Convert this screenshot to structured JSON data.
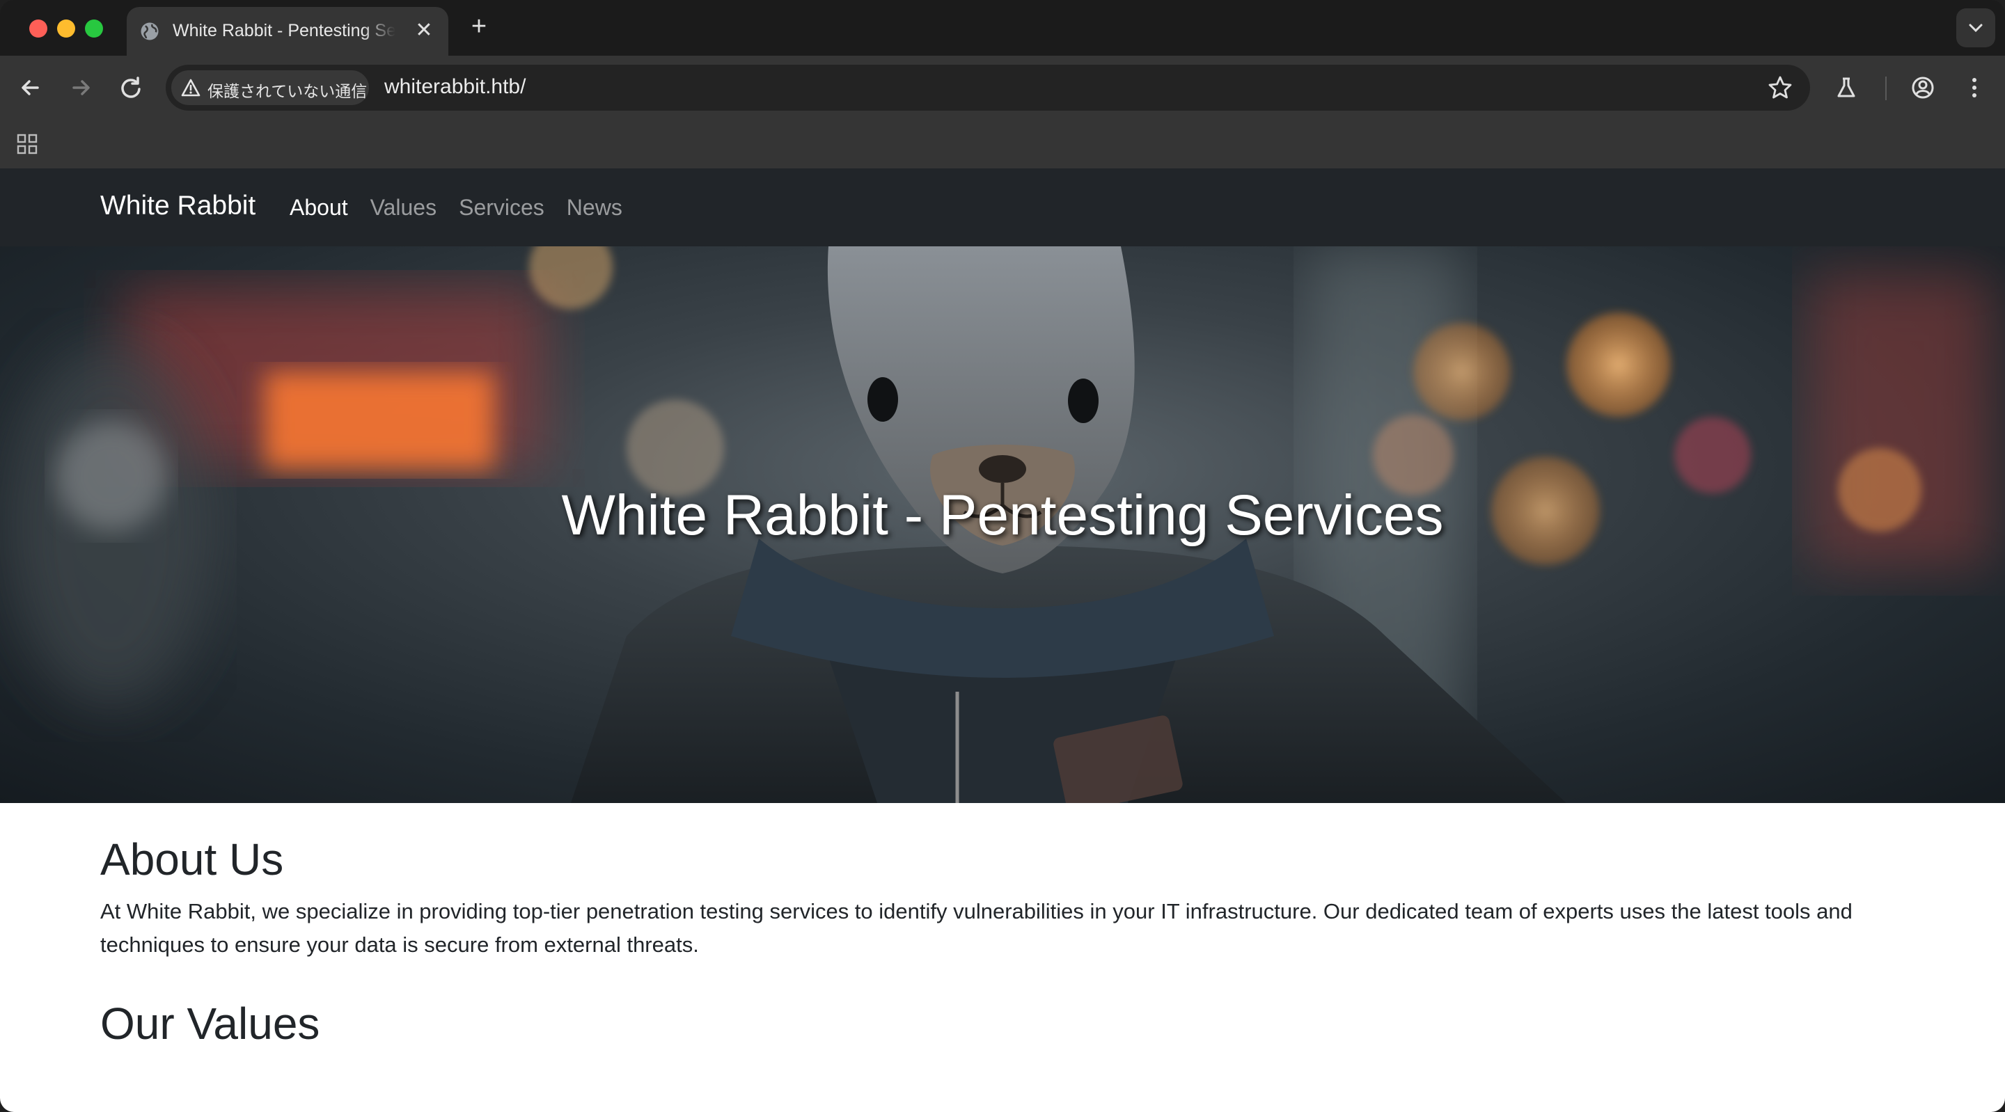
{
  "browser": {
    "tab_title": "White Rabbit - Pentesting Services",
    "tab_close": "✕",
    "new_tab": "+",
    "security_label": "保護されていない通信",
    "url": "whiterabbit.htb/"
  },
  "site": {
    "brand": "White Rabbit",
    "nav": [
      {
        "label": "About",
        "active": true
      },
      {
        "label": "Values",
        "active": false
      },
      {
        "label": "Services",
        "active": false
      },
      {
        "label": "News",
        "active": false
      }
    ],
    "hero_title": "White Rabbit - Pentesting Services",
    "about_heading": "About Us",
    "about_text": "At White Rabbit, we specialize in providing top-tier penetration testing services to identify vulnerabilities in your IT infrastructure. Our dedicated team of experts uses the latest tools and techniques to ensure your data is secure from external threats.",
    "values_heading": "Our Values"
  },
  "colors": {
    "navbar_bg": "#212529",
    "chrome_dark": "#1b1b1b",
    "toolbar": "#353535"
  }
}
